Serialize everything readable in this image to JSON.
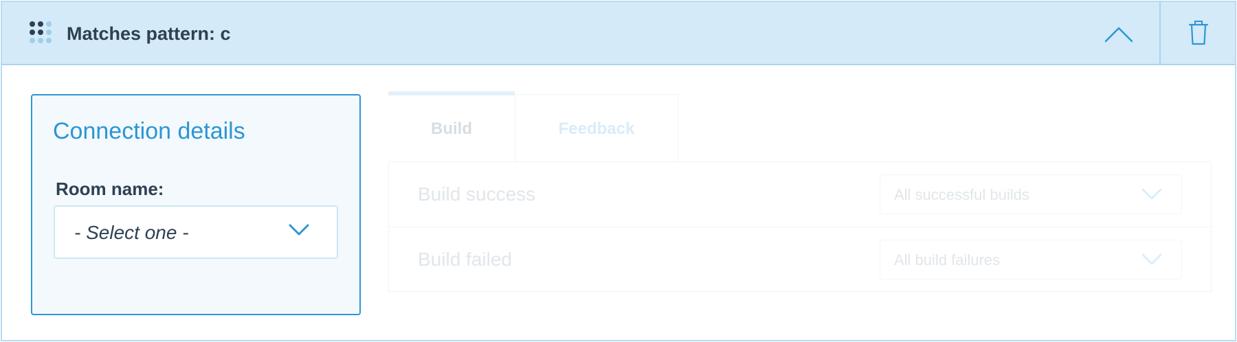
{
  "header": {
    "title": "Matches pattern: c",
    "grip_icon": "drag-grip-icon",
    "collapse_icon": "chevron-up-icon",
    "delete_icon": "trash-icon"
  },
  "connection": {
    "title": "Connection details",
    "room_label": "Room name:",
    "room_select_value": "- Select one -"
  },
  "tabs": [
    {
      "label": "Build"
    },
    {
      "label": "Feedback"
    }
  ],
  "rows": [
    {
      "label": "Build success",
      "select_value": "All successful builds"
    },
    {
      "label": "Build failed",
      "select_value": "All build failures"
    }
  ],
  "colors": {
    "accent": "#2c96d3",
    "header_bg": "#d4eaf8",
    "text_dark": "#2e4054"
  }
}
